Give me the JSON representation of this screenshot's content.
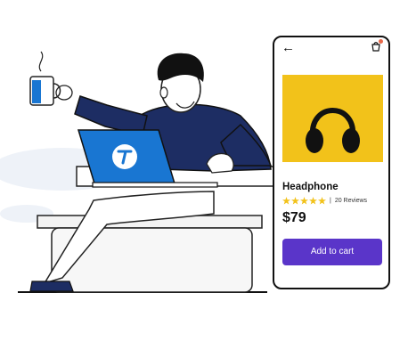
{
  "product": {
    "name": "Headphone",
    "rating": 5,
    "rating_max": 5,
    "reviews": "20 Reviews",
    "price": "$79"
  },
  "actions": {
    "add_to_cart": "Add to cart"
  },
  "icons": {
    "back": "back-arrow-icon",
    "cart": "shopping-bag-icon",
    "laptop_logo": "brand-logo-icon"
  },
  "colors": {
    "accent": "#5a35c9",
    "product_bg": "#f2c21a",
    "shirt": "#1d2d63",
    "laptop": "#1976d2",
    "star": "#f2c21a",
    "badge": "#e8694a"
  }
}
